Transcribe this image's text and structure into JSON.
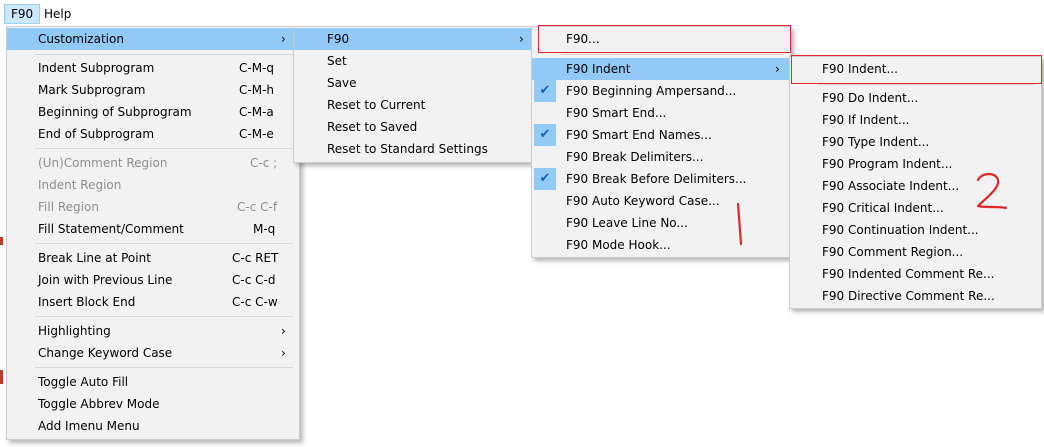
{
  "menubar": {
    "f90": "F90",
    "help": "Help"
  },
  "main_menu": {
    "customization": "Customization",
    "indent_subprogram": "Indent Subprogram",
    "indent_subprogram_sc": "C-M-q",
    "mark_subprogram": "Mark Subprogram",
    "mark_subprogram_sc": "C-M-h",
    "beginning_subprogram": "Beginning of Subprogram",
    "beginning_subprogram_sc": "C-M-a",
    "end_subprogram": "End of Subprogram",
    "end_subprogram_sc": "C-M-e",
    "uncomment_region": "(Un)Comment Region",
    "uncomment_region_sc": "C-c ;",
    "indent_region": "Indent Region",
    "fill_region": "Fill Region",
    "fill_region_sc": "C-c C-f",
    "fill_statement": "Fill Statement/Comment",
    "fill_statement_sc": "M-q",
    "break_line": "Break Line at Point",
    "break_line_sc": "C-c RET",
    "join_line": "Join with Previous Line",
    "join_line_sc": "C-c C-d",
    "insert_block_end": "Insert Block End",
    "insert_block_end_sc": "C-c C-w",
    "highlighting": "Highlighting",
    "change_keyword_case": "Change Keyword Case",
    "toggle_auto_fill": "Toggle Auto Fill",
    "toggle_abbrev": "Toggle Abbrev Mode",
    "add_imenu": "Add Imenu Menu"
  },
  "sub1": {
    "f90": "F90",
    "set": "Set",
    "save": "Save",
    "reset_current": "Reset to Current",
    "reset_saved": "Reset to Saved",
    "reset_standard": "Reset to Standard Settings"
  },
  "sub2": {
    "f90_dots": "F90...",
    "f90_indent": "F90 Indent",
    "beginning_ampersand": "F90 Beginning Ampersand...",
    "smart_end": "F90 Smart End...",
    "smart_end_names": "F90 Smart End Names...",
    "break_delimiters": "F90 Break Delimiters...",
    "break_before_delimiters": "F90 Break Before Delimiters...",
    "auto_keyword_case": "F90 Auto Keyword Case...",
    "leave_line_no": "F90 Leave Line No...",
    "mode_hook": "F90 Mode Hook..."
  },
  "sub3": {
    "f90_indent": "F90 Indent...",
    "do_indent": "F90 Do Indent...",
    "if_indent": "F90 If Indent...",
    "type_indent": "F90 Type Indent...",
    "program_indent": "F90 Program Indent...",
    "associate_indent": "F90 Associate Indent...",
    "critical_indent": "F90 Critical Indent...",
    "continuation_indent": "F90 Continuation Indent...",
    "comment_region": "F90 Comment Region...",
    "indented_comment": "F90 Indented Comment Re...",
    "directive_comment": "F90 Directive Comment Re..."
  },
  "annotations": {
    "mark1": "1",
    "mark2": "2"
  },
  "colors": {
    "highlight": "#91c9f7",
    "menu_bg": "#f2f2f2",
    "annotation_red": "#e0262a"
  }
}
